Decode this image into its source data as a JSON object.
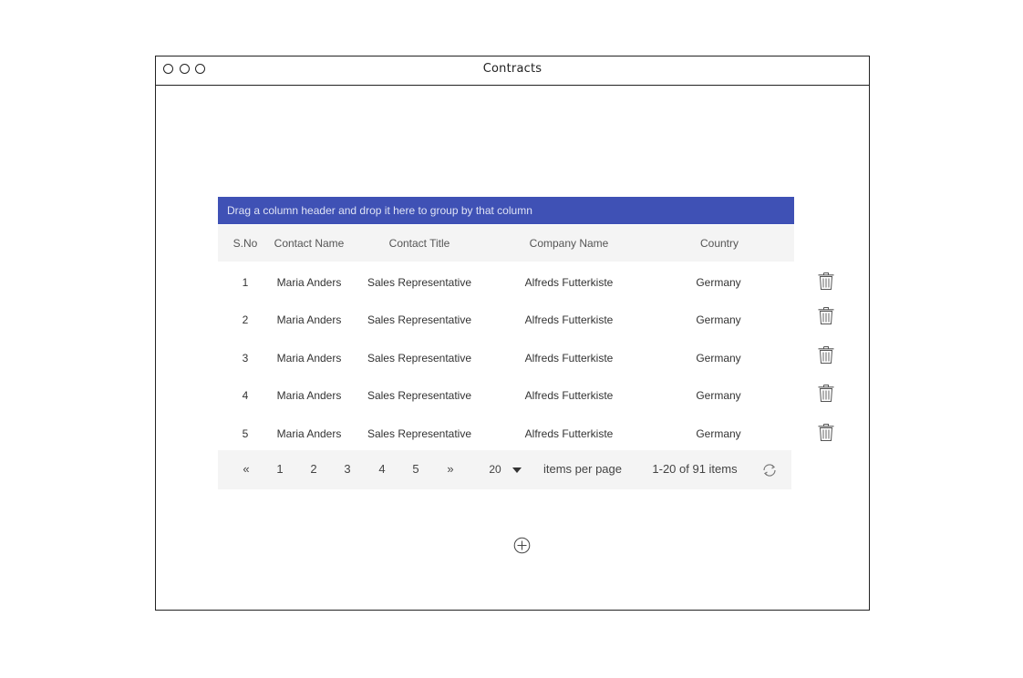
{
  "window": {
    "title": "Contracts"
  },
  "grid": {
    "group_hint": "Drag a column header and drop it here to group by that column",
    "columns": [
      "S.No",
      "Contact Name",
      "Contact Title",
      "Company Name",
      "Country"
    ],
    "rows": [
      [
        "1",
        "Maria Anders",
        "Sales Representative",
        "Alfreds Futterkiste",
        "Germany"
      ],
      [
        "2",
        "Maria Anders",
        "Sales Representative",
        "Alfreds Futterkiste",
        "Germany"
      ],
      [
        "3",
        "Maria Anders",
        "Sales Representative",
        "Alfreds Futterkiste",
        "Germany"
      ],
      [
        "4",
        "Maria Anders",
        "Sales Representative",
        "Alfreds Futterkiste",
        "Germany"
      ],
      [
        "5",
        "Maria Anders",
        "Sales Representative",
        "Alfreds Futterkiste",
        "Germany"
      ]
    ],
    "row_action_icon": "trash-icon"
  },
  "pager": {
    "first_label": "«",
    "pages": [
      "1",
      "2",
      "3",
      "4",
      "5"
    ],
    "last_label": "»",
    "page_size": "20",
    "items_per_page_label": "items per page",
    "summary": "1-20 of 91 items",
    "refresh_icon": "refresh-icon"
  },
  "add_icon": "plus-circle-icon",
  "colors": {
    "accent": "#3f51b5",
    "header_bg": "#f4f4f4"
  }
}
